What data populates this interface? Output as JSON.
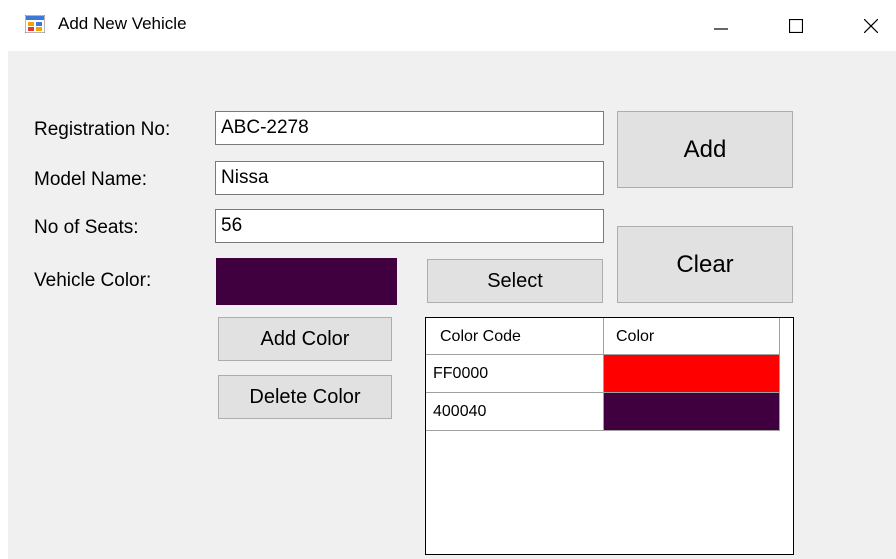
{
  "window": {
    "title": "Add New Vehicle",
    "icon": "app-form-icon",
    "controls": [
      "minimize-icon",
      "maximize-icon",
      "close-icon"
    ]
  },
  "form": {
    "registration_label": "Registration No:",
    "registration_value": "ABC-2278",
    "model_label": "Model Name:",
    "model_value": "Nissa",
    "seats_label": "No of Seats:",
    "seats_value": "56",
    "color_label": "Vehicle Color:",
    "vehicle_color": "#400040"
  },
  "buttons": {
    "add": "Add",
    "clear": "Clear",
    "select": "Select",
    "add_color": "Add Color",
    "delete_color": "Delete Color"
  },
  "color_grid": {
    "headers": [
      "Color Code",
      "Color"
    ],
    "rows": [
      {
        "code": "FF0000",
        "color": "#ff0000"
      },
      {
        "code": "400040",
        "color": "#400040"
      }
    ]
  },
  "theme": {
    "form_background": "#f0f0f0",
    "button_face": "#e1e1e1"
  }
}
